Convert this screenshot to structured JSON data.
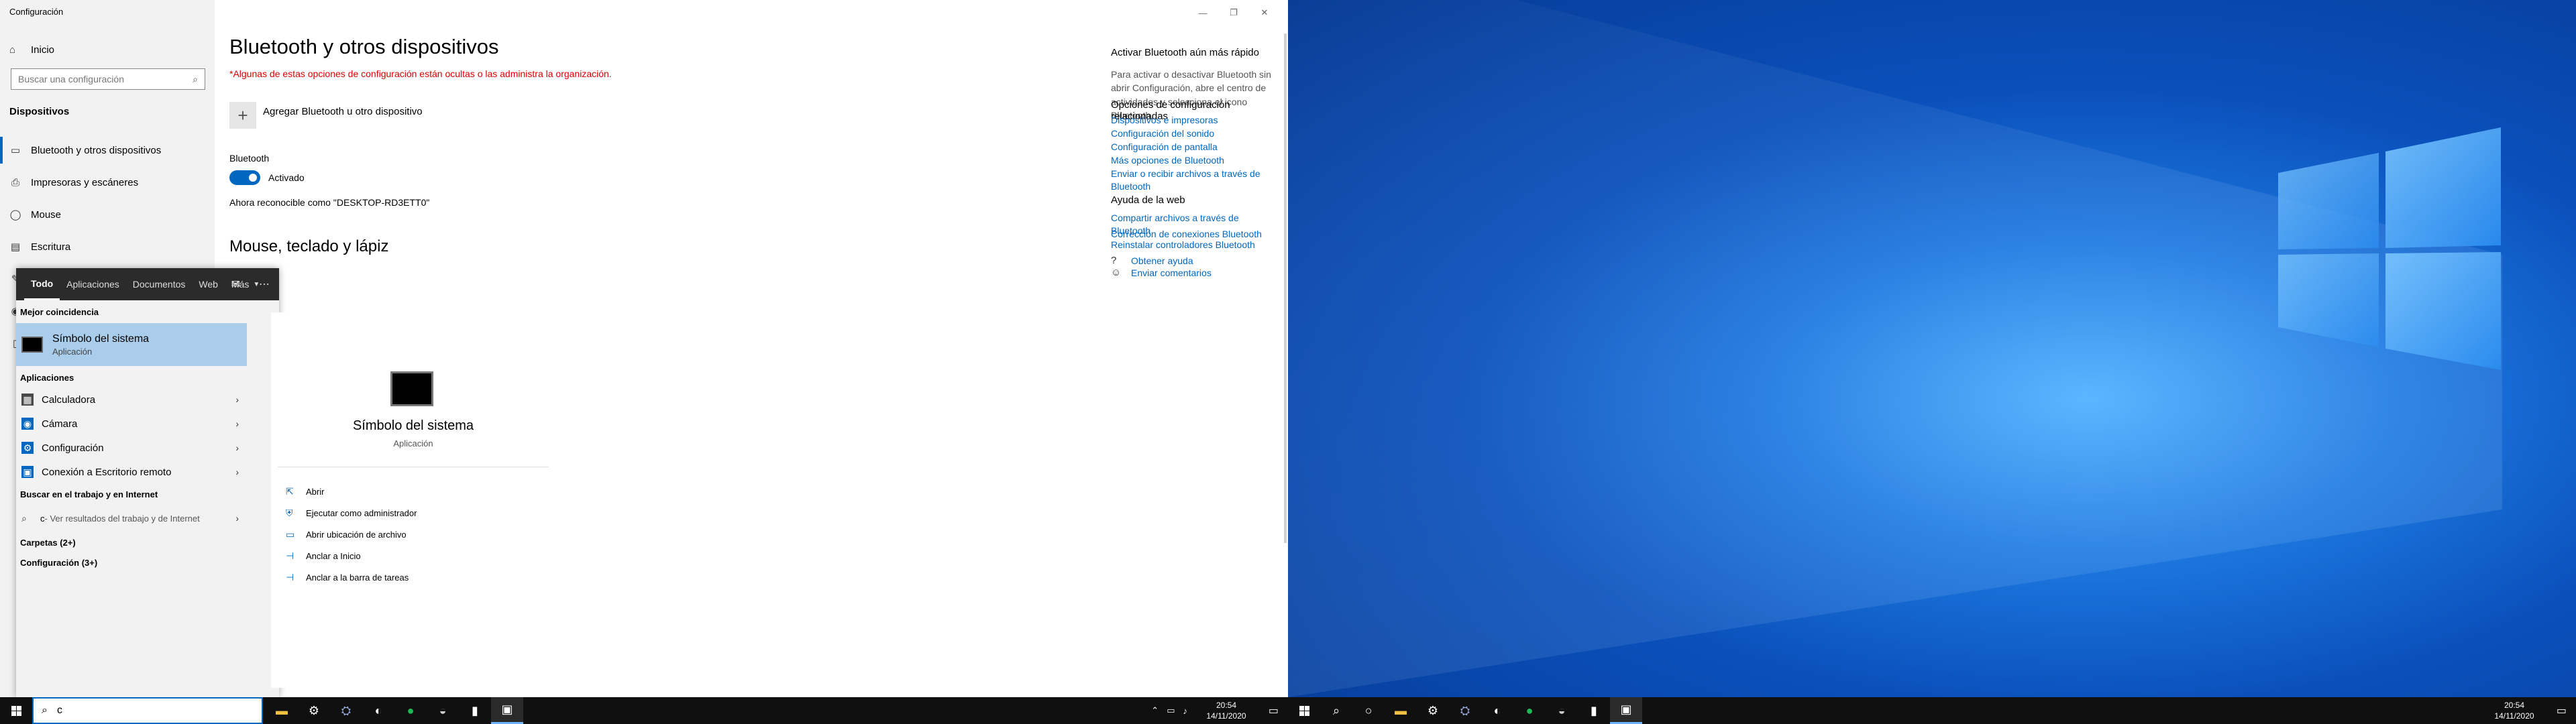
{
  "settings": {
    "app_title": "Configuración",
    "sidebar": {
      "home": "Inicio",
      "search_placeholder": "Buscar una configuración",
      "section": "Dispositivos",
      "items": [
        {
          "label": "Bluetooth y otros dispositivos",
          "icon": "bluetooth-icon",
          "active": true
        },
        {
          "label": "Impresoras y escáneres",
          "icon": "printer-icon"
        },
        {
          "label": "Mouse",
          "icon": "mouse-icon"
        },
        {
          "label": "Escritura",
          "icon": "keyboard-icon"
        }
      ]
    },
    "main": {
      "title": "Bluetooth y otros dispositivos",
      "org_note": "*Algunas de estas opciones de configuración están ocultas o las administra la organización.",
      "add_device": "Agregar Bluetooth u otro dispositivo",
      "bluetooth_label": "Bluetooth",
      "bluetooth_state": "Activado",
      "bluetooth_on": true,
      "discoverable": "Ahora reconocible como \"DESKTOP-RD3ETT0\"",
      "mouse_heading": "Mouse, teclado y lápiz"
    },
    "right_column": {
      "quick_title": "Activar Bluetooth aún más rápido",
      "quick_text": "Para activar o desactivar Bluetooth sin abrir Configuración, abre el centro de actividades y selecciona el icono Bluetooth.",
      "related_title": "Opciones de configuración relacionadas",
      "related_links": [
        "Dispositivos e impresoras",
        "Configuración del sonido",
        "Configuración de pantalla",
        "Más opciones de Bluetooth",
        "Enviar o recibir archivos a través de Bluetooth"
      ],
      "web_title": "Ayuda de la web",
      "web_links": [
        "Compartir archivos a través de Bluetooth",
        "Corrección de conexiones Bluetooth",
        "Reinstalar controladores Bluetooth"
      ],
      "help": "Obtener ayuda",
      "feedback": "Enviar comentarios"
    }
  },
  "start_menu": {
    "tabs": [
      "Todo",
      "Aplicaciones",
      "Documentos",
      "Web",
      "Más"
    ],
    "best_match_heading": "Mejor coincidencia",
    "best_match": {
      "name": "Símbolo del sistema",
      "type": "Aplicación"
    },
    "apps_heading": "Aplicaciones",
    "apps": [
      {
        "label": "Calculadora",
        "icon": "calculator-icon",
        "color": "#4a4a4a"
      },
      {
        "label": "Cámara",
        "icon": "camera-icon",
        "color": "#0067c0"
      },
      {
        "label": "Configuración",
        "icon": "gear-icon",
        "color": "#0067c0"
      },
      {
        "label": "Conexión a Escritorio remoto",
        "icon": "remote-desktop-icon",
        "color": "#0067c0"
      }
    ],
    "web_heading": "Buscar en el trabajo y en Internet",
    "web_result_query": "c",
    "web_result_suffix": " - Ver resultados del trabajo y de Internet",
    "folders": "Carpetas (2+)",
    "settings_group": "Configuración (3+)",
    "preview": {
      "name": "Símbolo del sistema",
      "type": "Aplicación",
      "actions": [
        {
          "label": "Abrir",
          "icon": "open-icon"
        },
        {
          "label": "Ejecutar como administrador",
          "icon": "shield-icon"
        },
        {
          "label": "Abrir ubicación de archivo",
          "icon": "folder-icon"
        },
        {
          "label": "Anclar a Inicio",
          "icon": "pin-icon"
        },
        {
          "label": "Anclar a la barra de tareas",
          "icon": "pin-icon"
        }
      ]
    }
  },
  "taskbar_left": {
    "search_text": "c",
    "time": "20:54",
    "date": "14/11/2020"
  },
  "taskbar_right": {
    "time": "20:54",
    "date": "14/11/2020"
  },
  "colors": {
    "accent": "#0067c0",
    "warning": "#dd0000",
    "desktop": "#0a58c8"
  }
}
